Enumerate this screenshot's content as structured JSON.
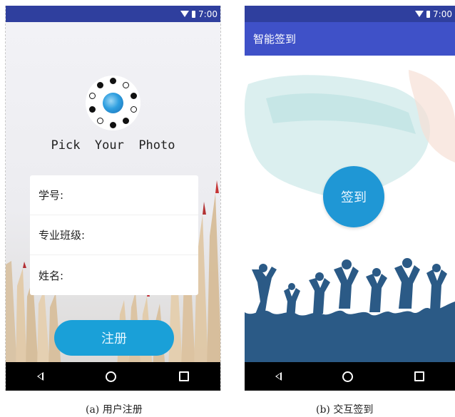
{
  "status_bar": {
    "time": "7:00",
    "icons": [
      "wifi-icon",
      "battery-icon"
    ]
  },
  "nav_bar": {
    "icons": [
      "back-icon",
      "home-icon",
      "recent-apps-icon"
    ]
  },
  "screen_a": {
    "app_title": "Pick  Your  Photo",
    "form": {
      "student_id_label": "学号:",
      "class_label": "专业班级:",
      "name_label": "姓名:"
    },
    "register_button": "注册",
    "caption": "(a)  用户注册"
  },
  "screen_b": {
    "toolbar_title": "智能签到",
    "checkin_button": "签到",
    "caption": "(b)  交互签到"
  },
  "colors": {
    "status_bar": "#2f3f9e",
    "toolbar": "#3f51c8",
    "accent_button": "#1aa0d8",
    "nav_bar": "#000000"
  }
}
